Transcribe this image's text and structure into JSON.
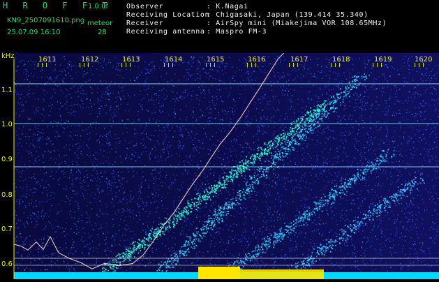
{
  "header": {
    "logo": "H R O F F T",
    "version": "1.0.0f",
    "filename": "KN9_2507091610.png",
    "meteor_label": "meteor",
    "datetime": "25.07.09 16:10",
    "meteor_count": "28",
    "info": [
      {
        "label": "Observer",
        "value": ": K.Nagai"
      },
      {
        "label": "Receiving Location",
        "value": ": Chigasaki, Japan (139.414 35.340)"
      },
      {
        "label": "Receiver",
        "value": ": AirSpy mini (Miakejima VOR 108.65MHz)"
      },
      {
        "label": "Receiving antenna",
        "value": ": Maspro FM-3"
      }
    ]
  },
  "spectrogram": {
    "y_unit": "kHz",
    "y_ticks": [
      "1.1",
      "1.0",
      "0.9",
      "0.8",
      "0.7",
      "0.6"
    ],
    "x_ticks": [
      "1611",
      "1612",
      "1613",
      "1614",
      "1615",
      "1616",
      "1617",
      "1618",
      "1619",
      "1620"
    ],
    "colors": {
      "background": "#0a0a3a",
      "noise": "#2a5cff",
      "signal": "#33ffd6",
      "carrier": "#66e6ff",
      "bottom_bar": "#00d8ff",
      "yellow_bar": "#ffe600"
    }
  }
}
